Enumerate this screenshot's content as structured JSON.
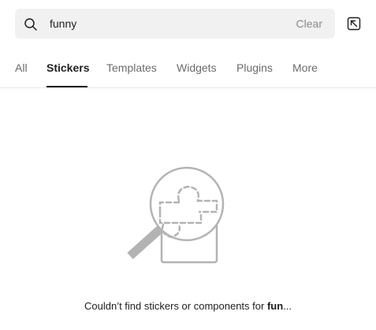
{
  "search": {
    "value": "funny",
    "clear_label": "Clear",
    "icon": "search-icon"
  },
  "collapse": {
    "icon": "collapse-panel-icon"
  },
  "tabs": [
    {
      "label": "All",
      "active": false
    },
    {
      "label": "Stickers",
      "active": true
    },
    {
      "label": "Templates",
      "active": false
    },
    {
      "label": "Widgets",
      "active": false
    },
    {
      "label": "Plugins",
      "active": false
    },
    {
      "label": "More",
      "active": false
    }
  ],
  "empty_state": {
    "illustration": "magnifier-puzzle-illustration",
    "message_prefix": "Couldn’t find stickers or components for ",
    "message_query": "fun",
    "message_suffix": "..."
  },
  "colors": {
    "search_bg": "#f1f1f1",
    "text_primary": "#1e1e1e",
    "text_muted": "#8a8a8a",
    "tab_inactive": "#6b6b6b",
    "divider": "#e6e6e6",
    "illustration_gray": "#b3b3b3"
  }
}
